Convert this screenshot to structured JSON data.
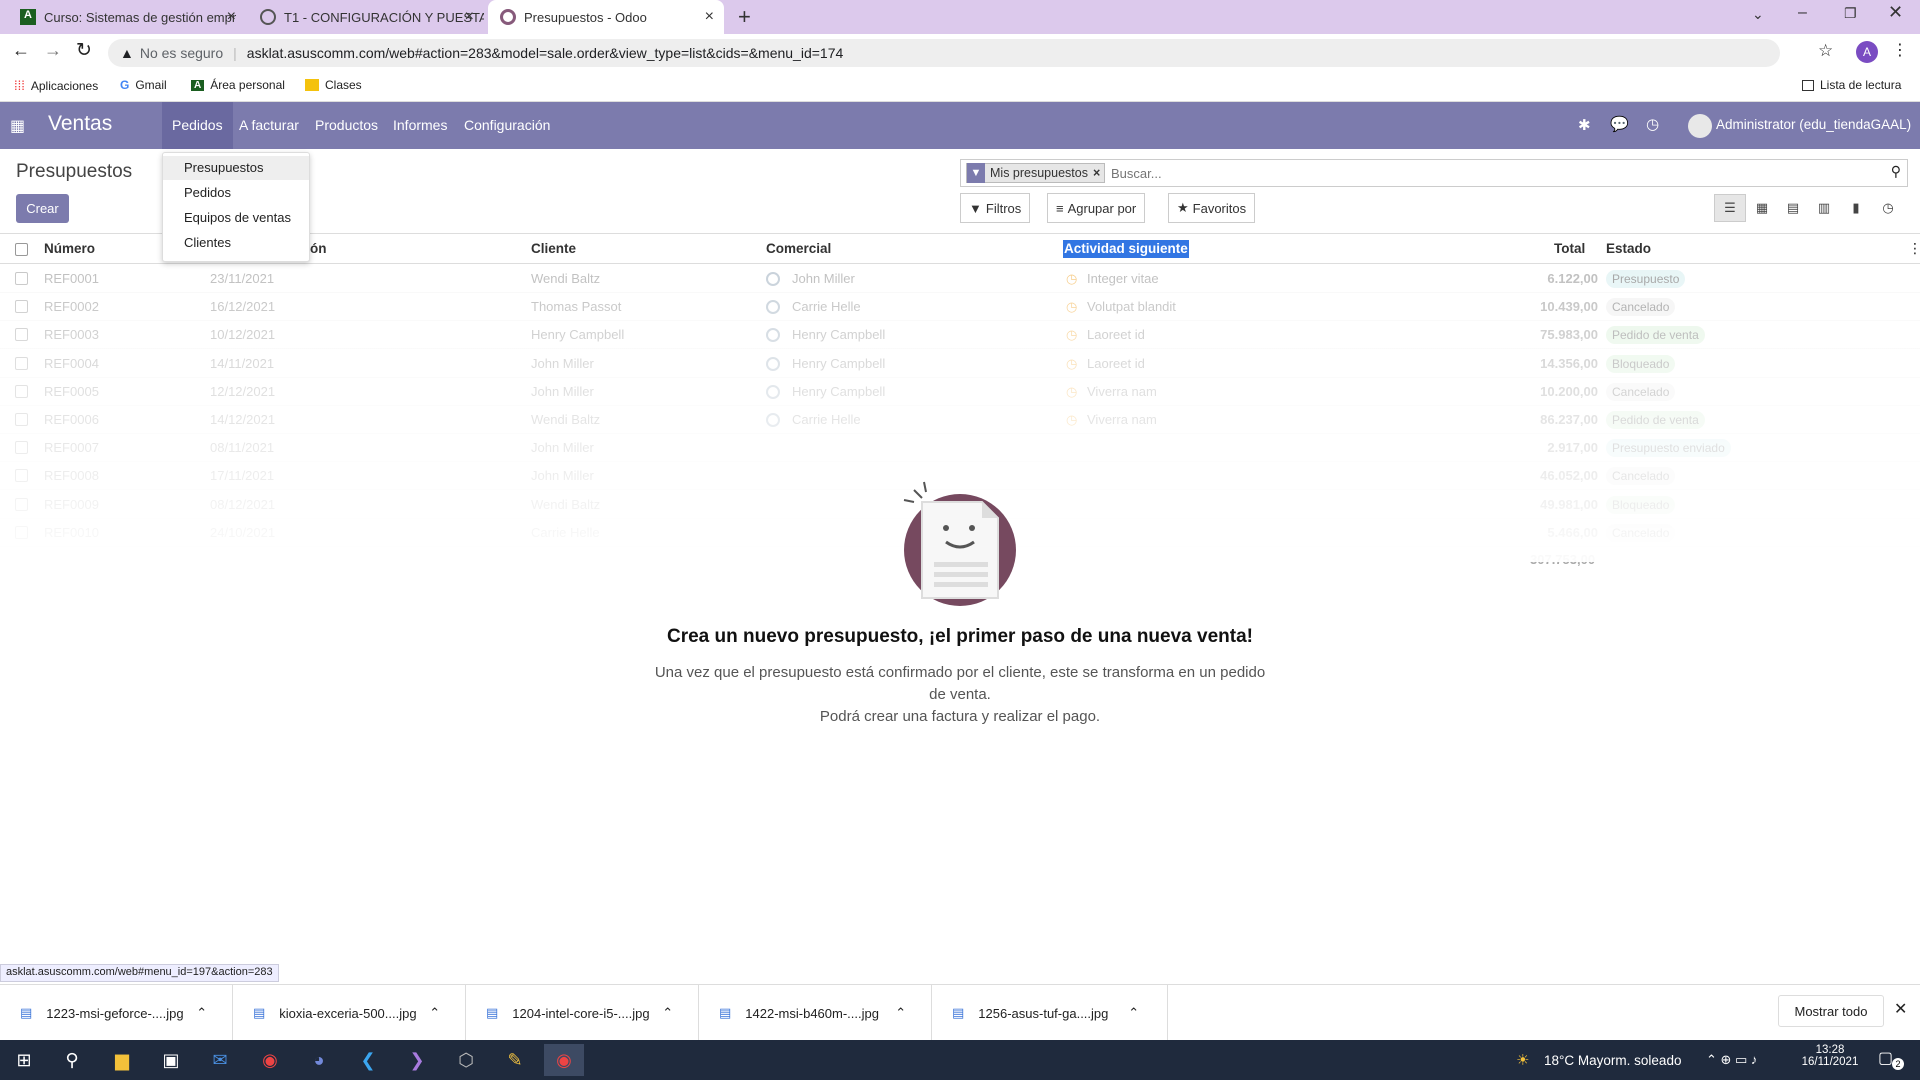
{
  "browser": {
    "tabs": [
      {
        "title": "Curso: Sistemas de gestión empr"
      },
      {
        "title": "T1 - CONFIGURACIÓN Y PUESTA"
      },
      {
        "title": "Presupuestos - Odoo"
      }
    ],
    "security_label": "No es seguro",
    "url": "asklat.asuscomm.com/web#action=283&model=sale.order&view_type=list&cids=&menu_id=174",
    "profile_initial": "A",
    "bookmarks": [
      "Aplicaciones",
      "Gmail",
      "Área personal",
      "Clases"
    ],
    "reading_list": "Lista de lectura"
  },
  "app": {
    "name": "Ventas",
    "menus": [
      "Pedidos",
      "A facturar",
      "Productos",
      "Informes",
      "Configuración"
    ],
    "user": "Administrator (edu_tiendaGAAL)",
    "dropdown": [
      "Presupuestos",
      "Pedidos",
      "Equipos de ventas",
      "Clientes"
    ]
  },
  "control": {
    "breadcrumb": "Presupuestos",
    "create_label": "Crear",
    "search_facet": "Mis presupuestos",
    "search_placeholder": "Buscar...",
    "filters": "Filtros",
    "group_by": "Agrupar por",
    "favorites": "Favoritos"
  },
  "table": {
    "headers": [
      "Número",
      "ón",
      "Cliente",
      "Comercial",
      "Actividad siguiente",
      "Total",
      "Estado"
    ],
    "rows": [
      {
        "num": "REF0001",
        "date": "23/11/2021",
        "client": "Wendi Baltz",
        "sales": "John Miller",
        "activity": "Integer vitae",
        "total": "6.122,00",
        "state": "Presupuesto"
      },
      {
        "num": "REF0002",
        "date": "16/12/2021",
        "client": "Thomas Passot",
        "sales": "Carrie Helle",
        "activity": "Volutpat blandit",
        "total": "10.439,00",
        "state": "Cancelado"
      },
      {
        "num": "REF0003",
        "date": "10/12/2021",
        "client": "Henry Campbell",
        "sales": "Henry Campbell",
        "activity": "Laoreet id",
        "total": "75.983,00",
        "state": "Pedido de venta"
      },
      {
        "num": "REF0004",
        "date": "14/11/2021",
        "client": "John Miller",
        "sales": "Henry Campbell",
        "activity": "Laoreet id",
        "total": "14.356,00",
        "state": "Bloqueado"
      },
      {
        "num": "REF0005",
        "date": "12/12/2021",
        "client": "John Miller",
        "sales": "Henry Campbell",
        "activity": "Viverra nam",
        "total": "10.200,00",
        "state": "Cancelado"
      },
      {
        "num": "REF0006",
        "date": "14/12/2021",
        "client": "Wendi Baltz",
        "sales": "Carrie Helle",
        "activity": "Viverra nam",
        "total": "86.237,00",
        "state": "Pedido de venta"
      },
      {
        "num": "REF0007",
        "date": "08/11/2021",
        "client": "John Miller",
        "sales": "",
        "activity": "",
        "total": "2.917,00",
        "state": "Presupuesto enviado"
      },
      {
        "num": "REF0008",
        "date": "17/11/2021",
        "client": "John Miller",
        "sales": "",
        "activity": "",
        "total": "46.052,00",
        "state": "Cancelado"
      },
      {
        "num": "REF0009",
        "date": "08/12/2021",
        "client": "Wendi Baltz",
        "sales": "",
        "activity": "",
        "total": "49.981,00",
        "state": "Bloqueado"
      },
      {
        "num": "REF0010",
        "date": "24/10/2021",
        "client": "Carrie Helle",
        "sales": "",
        "activity": "",
        "total": "5.466,00",
        "state": "Cancelado"
      }
    ],
    "sum_total": "307.753,00"
  },
  "helper": {
    "title": "Crea un nuevo presupuesto, ¡el primer paso de una nueva venta!",
    "line1": "Una vez que el presupuesto está confirmado por el cliente, este se transforma en un pedido de venta.",
    "line2": "Podrá crear una factura y realizar el pago."
  },
  "status_url": "asklat.asuscomm.com/web#menu_id=197&action=283",
  "downloads": {
    "files": [
      "1223-msi-geforce-....jpg",
      "kioxia-exceria-500....jpg",
      "1204-intel-core-i5-....jpg",
      "1422-msi-b460m-....jpg",
      "1256-asus-tuf-ga....jpg"
    ],
    "show_all": "Mostrar todo"
  },
  "taskbar": {
    "weather": "18°C  Mayorm. soleado",
    "time": "13:28",
    "date": "16/11/2021",
    "notifications": "2"
  },
  "colors": {
    "navbar": "#7c7bad",
    "primary": "#7c7bad",
    "tabbar": "#dcc9ec",
    "taskbar": "#1f2a3d"
  }
}
